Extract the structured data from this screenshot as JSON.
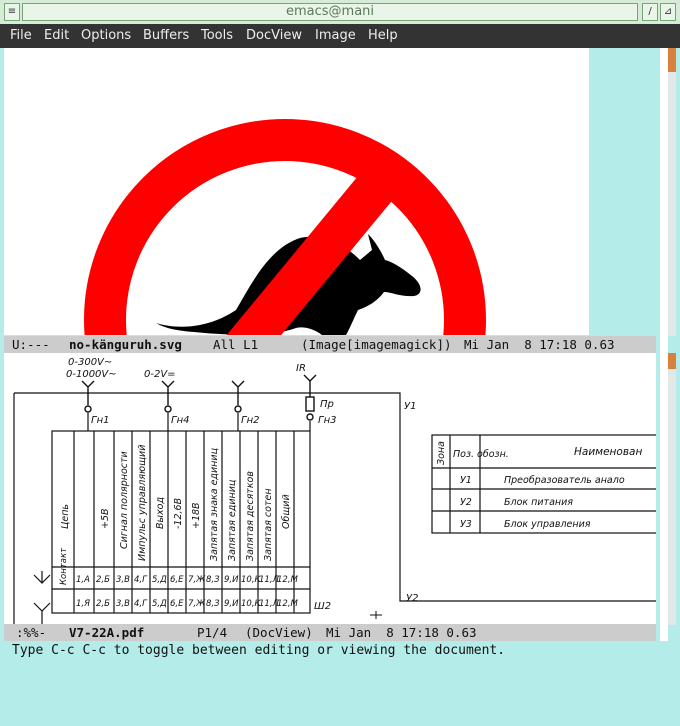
{
  "window": {
    "title": "emacs@mani",
    "left_button_glyph": "≡",
    "right_buttons": [
      "/",
      "⊿"
    ]
  },
  "menubar": {
    "items": [
      "File",
      "Edit",
      "Options",
      "Buffers",
      "Tools",
      "DocView",
      "Image",
      "Help"
    ]
  },
  "top_modeline": {
    "status": "U:---",
    "buffer": "no-känguruh.svg",
    "position": "All L1",
    "modes": "(Image[imagemagick])",
    "time": "Mi Jan  8 17:18 0.63"
  },
  "bottom_modeline": {
    "status": ":%%-",
    "buffer": "V7-22A.pdf",
    "position": "P1/4",
    "modes": "(DocView)",
    "time": "Mi Jan  8 17:18 0.63"
  },
  "echo_area": "Type C-c C-c to toggle between editing or viewing the document.",
  "colors": {
    "sign_red": "#ff0000",
    "kangaroo": "#000000",
    "frame_cyan": "#b4ece9",
    "menubar_bg": "#333333",
    "modeline_bg": "#cccccc",
    "scroll_thumb": "#d9803e"
  },
  "schematic": {
    "inputs": [
      "0-300V~",
      "0-1000V~",
      "0-2V=",
      "IR"
    ],
    "connectors": [
      "Гн1",
      "Гн4",
      "Гн2",
      "Гн3",
      "Пр",
      "У1",
      "У2",
      "Ш2"
    ],
    "columns": [
      "Цепь",
      "+5В",
      "Сигнал полярности",
      "Импульс управляющий",
      "Выход",
      "-12,6В",
      "+18В",
      "Запятая знака единиц",
      "Запятая единиц",
      "Запятая десятков",
      "Запятая сотен",
      "Общий"
    ],
    "contacts_label": "Контакт",
    "contacts": [
      "1,А",
      "2,Б",
      "3,В",
      "4,Г",
      "5,Д",
      "6,Е",
      "7,Ж",
      "8,З",
      "9,И",
      "10,К",
      "11,Л",
      "12,М"
    ],
    "contacts_row2": [
      "1,Я",
      "2,Б",
      "3,В",
      "4,Г",
      "5,Д",
      "6,Е",
      "7,Ж",
      "8,З",
      "9,И",
      "10,К",
      "11,Л",
      "12,М"
    ],
    "table_headers": [
      "Зона",
      "Поз. обозн.",
      "Наименован"
    ],
    "table_rows": [
      {
        "pos": "У1",
        "name": "Преобразователь анало"
      },
      {
        "pos": "У2",
        "name": "Блок питания"
      },
      {
        "pos": "У3",
        "name": "Блок управления"
      }
    ]
  }
}
